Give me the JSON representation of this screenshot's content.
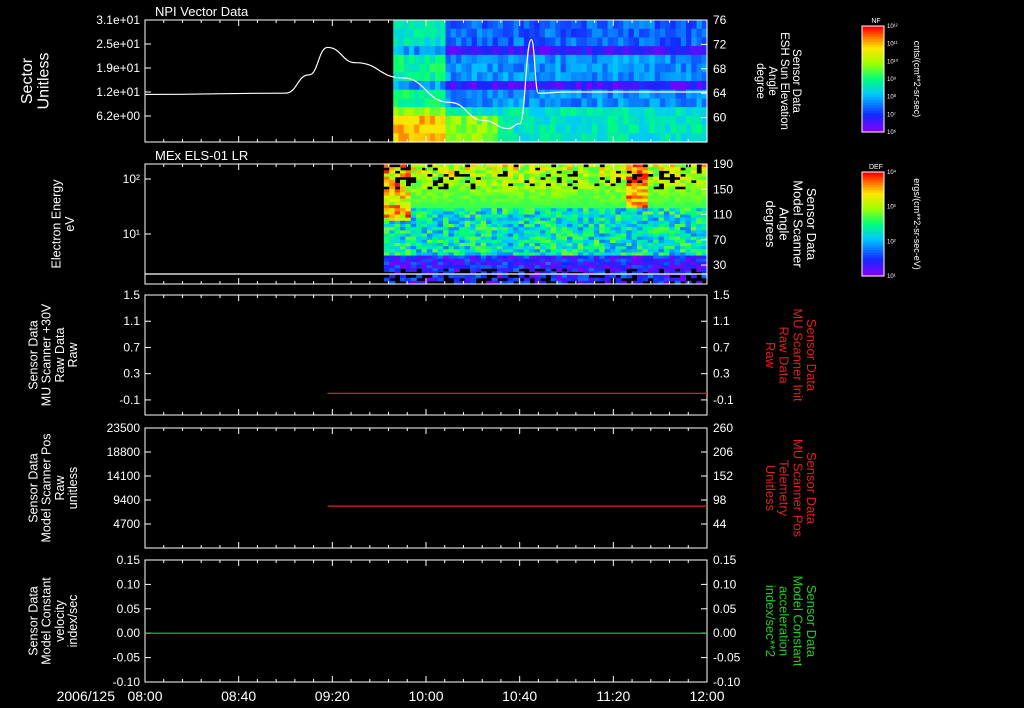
{
  "chart_data": [
    {
      "type": "heatmap",
      "title": "NPI Vector Data",
      "ylabel": "Sector\nUnitless",
      "y_ticks": [
        "3.1e+01",
        "2.5e+01",
        "1.9e+01",
        "1.2e+01",
        "6.2e+00"
      ],
      "y_right_label": "Sensor Data\nESH Sun Elevation\nAngle\ndegree",
      "y_right_ticks": [
        "76",
        "72",
        "68",
        "64",
        "60"
      ],
      "y_right_range": [
        56,
        76
      ],
      "colorbar": {
        "label": "cnts/(cm**2-sr-sec)",
        "tag": "NF",
        "ticks": [
          "10¹²",
          "10¹¹",
          "10¹⁰",
          "10⁹",
          "10⁸",
          "10⁷",
          "10⁶"
        ]
      },
      "data_start": "09:46",
      "series": [
        {
          "x": [
            "08:00",
            "09:00",
            "09:10",
            "09:18",
            "09:30",
            "09:50",
            "10:10",
            "10:25",
            "10:35",
            "10:40",
            "10:45",
            "10:48",
            "11:00",
            "12:00"
          ],
          "y": [
            63.8,
            64.0,
            67.0,
            71.5,
            69.0,
            66.5,
            62.5,
            59.5,
            58.2,
            59.0,
            72.8,
            64.0,
            64.2,
            64.2
          ],
          "color": "#ffffff"
        }
      ]
    },
    {
      "type": "heatmap",
      "title": "MEx ELS-01 LR",
      "ylabel": "Electron Energy\neV",
      "y_ticks": [
        "10²",
        "10¹"
      ],
      "y_right_label": "Sensor Data\nModel Scanner\nAngle\ndegrees",
      "y_right_ticks": [
        "190",
        "150",
        "110",
        "70",
        "30"
      ],
      "y_right_range": [
        0,
        190
      ],
      "colorbar": {
        "label": "ergs/(cm**2-sr-sec-eV)",
        "tag": "DEF",
        "ticks": [
          "10⁴",
          "10³",
          "10²",
          "10¹"
        ]
      },
      "data_start": "09:42",
      "series": [
        {
          "x": [
            "08:00",
            "12:00"
          ],
          "y": [
            0,
            0
          ],
          "color": "#ffffff"
        }
      ]
    },
    {
      "type": "line",
      "ylabel": "Sensor Data\nMU Scanner +30V\nRaw Data\nRaw",
      "y_ticks": [
        "1.5",
        "1.1",
        "0.7",
        "0.3",
        "-0.1"
      ],
      "ylim": [
        -0.33,
        1.5
      ],
      "y_right_label": "Sensor Data\nMU Scanner Init\nRaw Data\nRaw",
      "y_right_ticks": [
        "1.5",
        "1.1",
        "0.7",
        "0.3",
        "-0.1"
      ],
      "series": [
        {
          "x": [
            "09:18",
            "12:00"
          ],
          "y": [
            0.0,
            0.0
          ],
          "color": "#dd2020"
        }
      ]
    },
    {
      "type": "line",
      "ylabel": "Sensor Data\nModel Scanner Pos\nRaw\nunitless",
      "y_ticks": [
        "23500",
        "18800",
        "14100",
        "9400",
        "4700"
      ],
      "ylim": [
        0,
        23500
      ],
      "y_right_label": "Sensor Data\nMU Scanner Pos\nTelemetry\nUnitless",
      "y_right_ticks": [
        "260",
        "206",
        "152",
        "98",
        "44"
      ],
      "series": [
        {
          "x": [
            "09:18",
            "12:00"
          ],
          "y": [
            8200,
            8200
          ],
          "color": "#dd2020"
        }
      ]
    },
    {
      "type": "line",
      "ylabel": "Sensor Data\nModel Constant\nvelocity\nindex/sec",
      "y_ticks": [
        "0.15",
        "0.10",
        "0.05",
        "0.00",
        "-0.05",
        "-0.10"
      ],
      "ylim": [
        -0.1,
        0.15
      ],
      "y_right_label": "Sensor Data\nModel Constant\nacceleration\nindex/sec**2",
      "y_right_ticks": [
        "0.15",
        "0.10",
        "0.05",
        "0.00",
        "-0.05",
        "-0.10"
      ],
      "series": [
        {
          "x": [
            "08:00",
            "12:00"
          ],
          "y": [
            0.0,
            0.0
          ],
          "color": "#22cc22"
        }
      ]
    }
  ],
  "x_axis": {
    "date": "2006/125",
    "ticks": [
      "08:00",
      "08:40",
      "09:20",
      "10:00",
      "10:40",
      "11:20",
      "12:00"
    ],
    "xlim": [
      "08:00",
      "12:00"
    ]
  },
  "colors": {
    "left_label": "#ffffff",
    "panel3_right": "#dd2020",
    "panel4_right": "#dd2020",
    "panel5_right": "#22cc22"
  }
}
